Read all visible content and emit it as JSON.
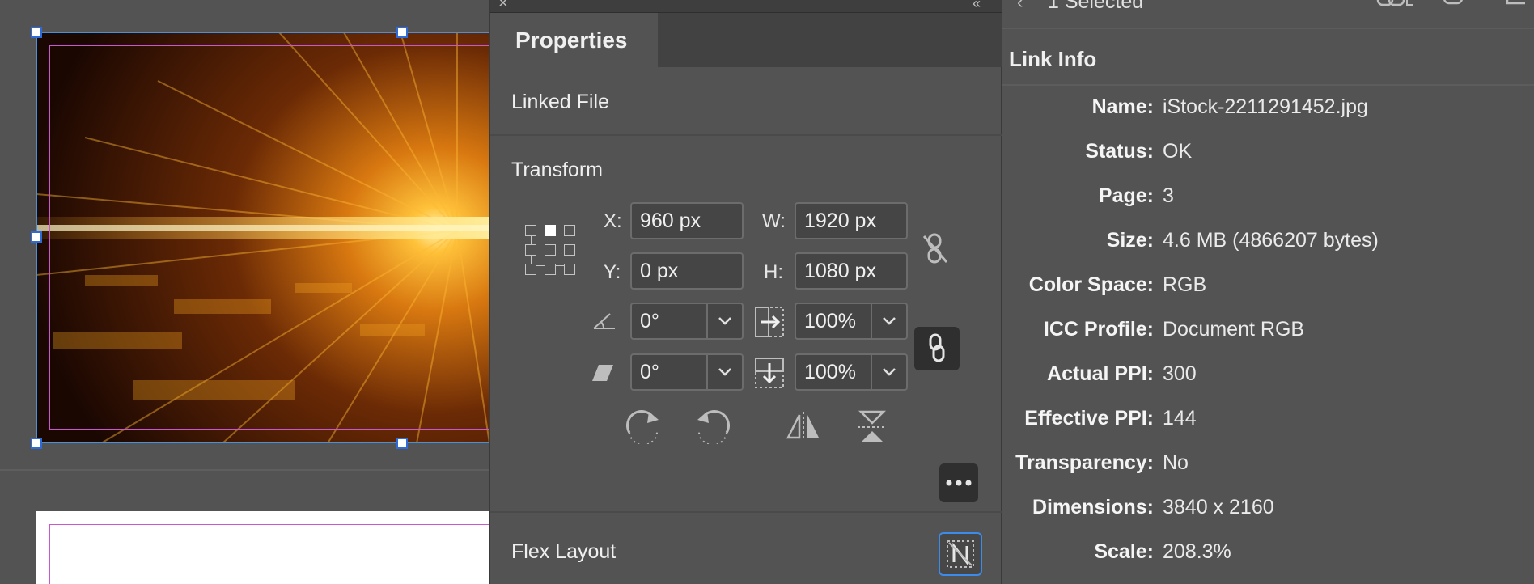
{
  "properties_panel": {
    "tab_label": "Properties",
    "linked_file_label": "Linked File",
    "transform_label": "Transform",
    "x_label": "X:",
    "x_value": "960 px",
    "y_label": "Y:",
    "y_value": "0 px",
    "w_label": "W:",
    "w_value": "1920 px",
    "h_label": "H:",
    "h_value": "1080 px",
    "rotation_value": "0°",
    "shear_value": "0°",
    "scale_x_value": "100%",
    "scale_y_value": "100%",
    "flex_layout_label": "Flex Layout"
  },
  "link_info": {
    "header_selected": "1 Selected",
    "title": "Link Info",
    "rows": [
      {
        "key": "Name:",
        "value": "iStock-2211291452.jpg"
      },
      {
        "key": "Status:",
        "value": "OK"
      },
      {
        "key": "Page:",
        "value": "3"
      },
      {
        "key": "Size:",
        "value": "4.6 MB (4866207 bytes)"
      },
      {
        "key": "Color Space:",
        "value": "RGB"
      },
      {
        "key": "ICC Profile:",
        "value": "Document RGB"
      },
      {
        "key": "Actual PPI:",
        "value": "300"
      },
      {
        "key": "Effective PPI:",
        "value": "144"
      },
      {
        "key": "Transparency:",
        "value": "No"
      },
      {
        "key": "Dimensions:",
        "value": "3840 x 2160"
      },
      {
        "key": "Scale:",
        "value": "208.3%"
      }
    ]
  },
  "colors": {
    "panel_bg": "#535353",
    "selection_blue": "#2f6bd8",
    "margin_magenta": "#c857d0",
    "flex_button_outline": "#3d8be8"
  },
  "icons": [
    "close-icon",
    "collapse-icon",
    "reference-point-icon",
    "rotate-angle-icon",
    "shear-icon",
    "scale-x-icon",
    "scale-y-icon",
    "constrain-unlinked-icon",
    "constrain-linked-icon",
    "rotate-cw-icon",
    "rotate-ccw-icon",
    "flip-horizontal-icon",
    "flip-vertical-icon",
    "more-options-icon",
    "flex-layout-icon"
  ]
}
